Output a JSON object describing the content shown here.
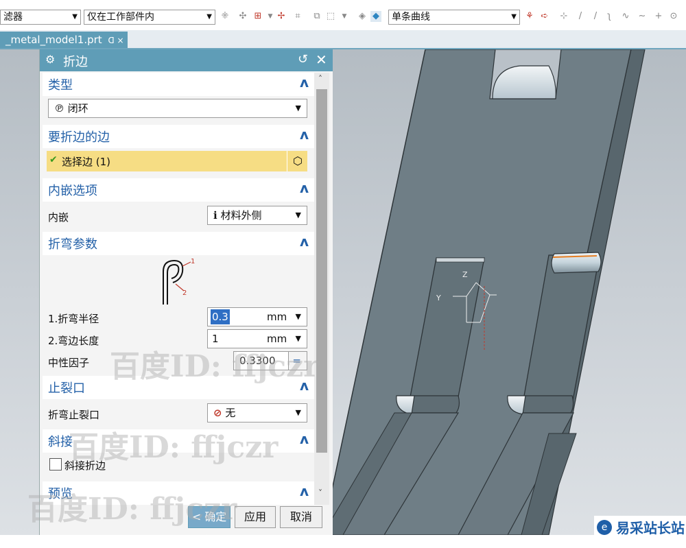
{
  "toolbar": {
    "filter_label": "滤器",
    "scope_value": "仅在工作部件内",
    "curve_rule_value": "单条曲线"
  },
  "tabs": {
    "file_tab_label": "_metal_model1.prt",
    "file_tab_marker": "ᗡ ×"
  },
  "dialog": {
    "title": "折边",
    "sections": {
      "type": {
        "title": "类型",
        "value": "闭环"
      },
      "edges": {
        "title": "要折边的边",
        "select_label": "选择边 (1)"
      },
      "inset": {
        "title": "内嵌选项",
        "label": "内嵌",
        "value": "材料外侧"
      },
      "bend_params": {
        "title": "折弯参数",
        "diagram_label_1": "1",
        "diagram_label_2": "2",
        "bend_radius_label": "1.折弯半径",
        "bend_radius_value": "0.3",
        "bend_radius_unit": "mm",
        "flange_length_label": "2.弯边长度",
        "flange_length_value": "1",
        "flange_length_unit": "mm",
        "k_factor_label": "中性因子",
        "k_factor_value": "0.3300",
        "k_factor_symbol": "="
      },
      "relief": {
        "title": "止裂口",
        "label": "折弯止裂口",
        "value": "无"
      },
      "miter": {
        "title": "斜接",
        "checkbox_label": "斜接折边",
        "checked": false
      },
      "preview": {
        "title": "预览"
      }
    },
    "buttons": {
      "ok": "< 确定 >",
      "apply": "应用",
      "cancel": "取消"
    }
  },
  "viewport": {
    "axis_y": "Y",
    "axis_z": "Z"
  },
  "watermark_text": "百度ID: ffjczr",
  "logo_text": "易采站长站",
  "colors": {
    "accent": "#5f9db7",
    "section_title": "#2461a8",
    "selection_highlight": "#f6dd84",
    "selected_text_bg": "#2f6fc4",
    "sheet_metal": "#6f7e86"
  }
}
